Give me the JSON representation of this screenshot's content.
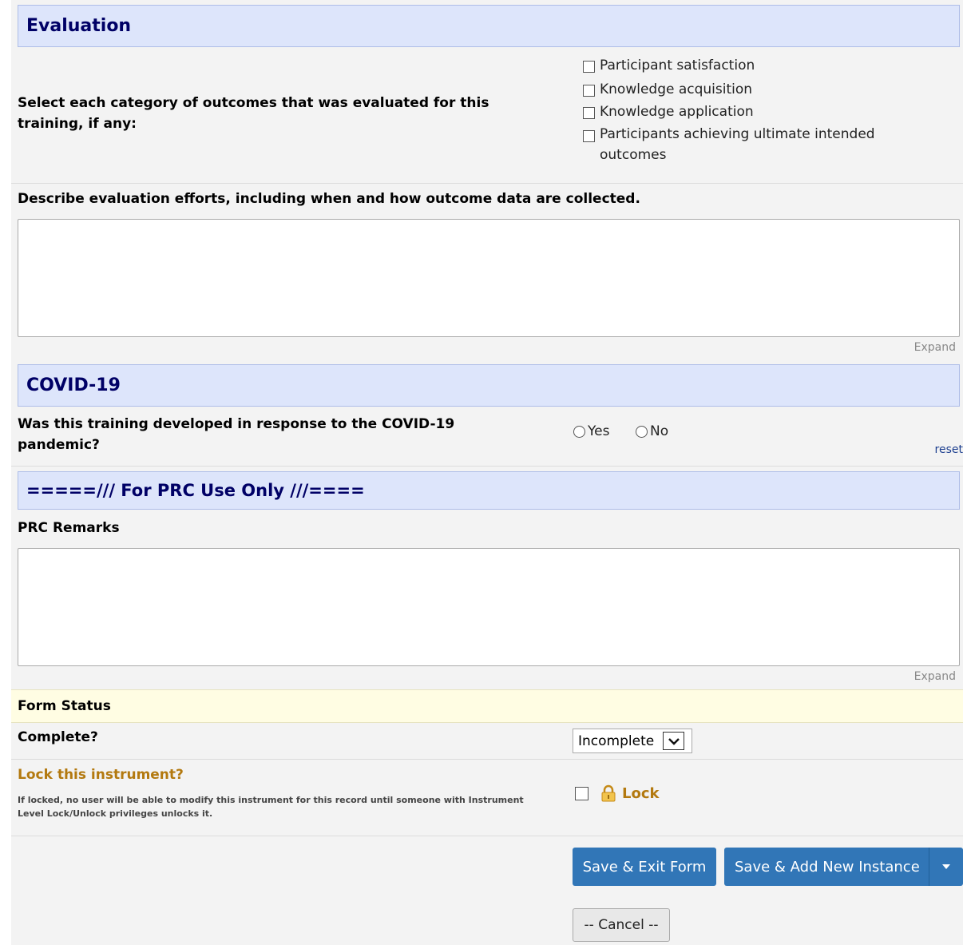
{
  "evaluation": {
    "header": "Evaluation",
    "outcomes_question": "Select each category of outcomes that was evaluated for this training, if any:",
    "outcomes_options": [
      "Participant satisfaction",
      "Knowledge acquisition",
      "Knowledge application",
      "Participants achieving ultimate intended outcomes"
    ],
    "efforts_question": "Describe evaluation efforts, including when and how outcome data are collected.",
    "efforts_value": "",
    "expand_label": "Expand"
  },
  "covid": {
    "header": "COVID-19",
    "question": "Was this training developed in response to the COVID-19 pandemic?",
    "option_yes": "Yes",
    "option_no": "No",
    "reset_label": "reset"
  },
  "prc": {
    "header": "=====/// For PRC Use Only ///====",
    "remarks_label": "PRC Remarks",
    "remarks_value": "",
    "expand_label": "Expand"
  },
  "form_status": {
    "header": "Form Status",
    "complete_label": "Complete?",
    "complete_value": "Incomplete",
    "lock_label": "Lock this instrument?",
    "lock_note": "If locked, no user will be able to modify this instrument for this record until someone with Instrument Level Lock/Unlock privileges unlocks it.",
    "lock_checkbox_label": "Lock"
  },
  "actions": {
    "save_exit": "Save & Exit Form",
    "save_add": "Save & Add New Instance",
    "cancel": "-- Cancel --"
  },
  "colors": {
    "section_header_bg": "#dde5fb",
    "section_header_text": "#000066",
    "form_status_bg": "#fffde3",
    "lock_label": "#b3790f",
    "primary_button": "#3176b7"
  }
}
